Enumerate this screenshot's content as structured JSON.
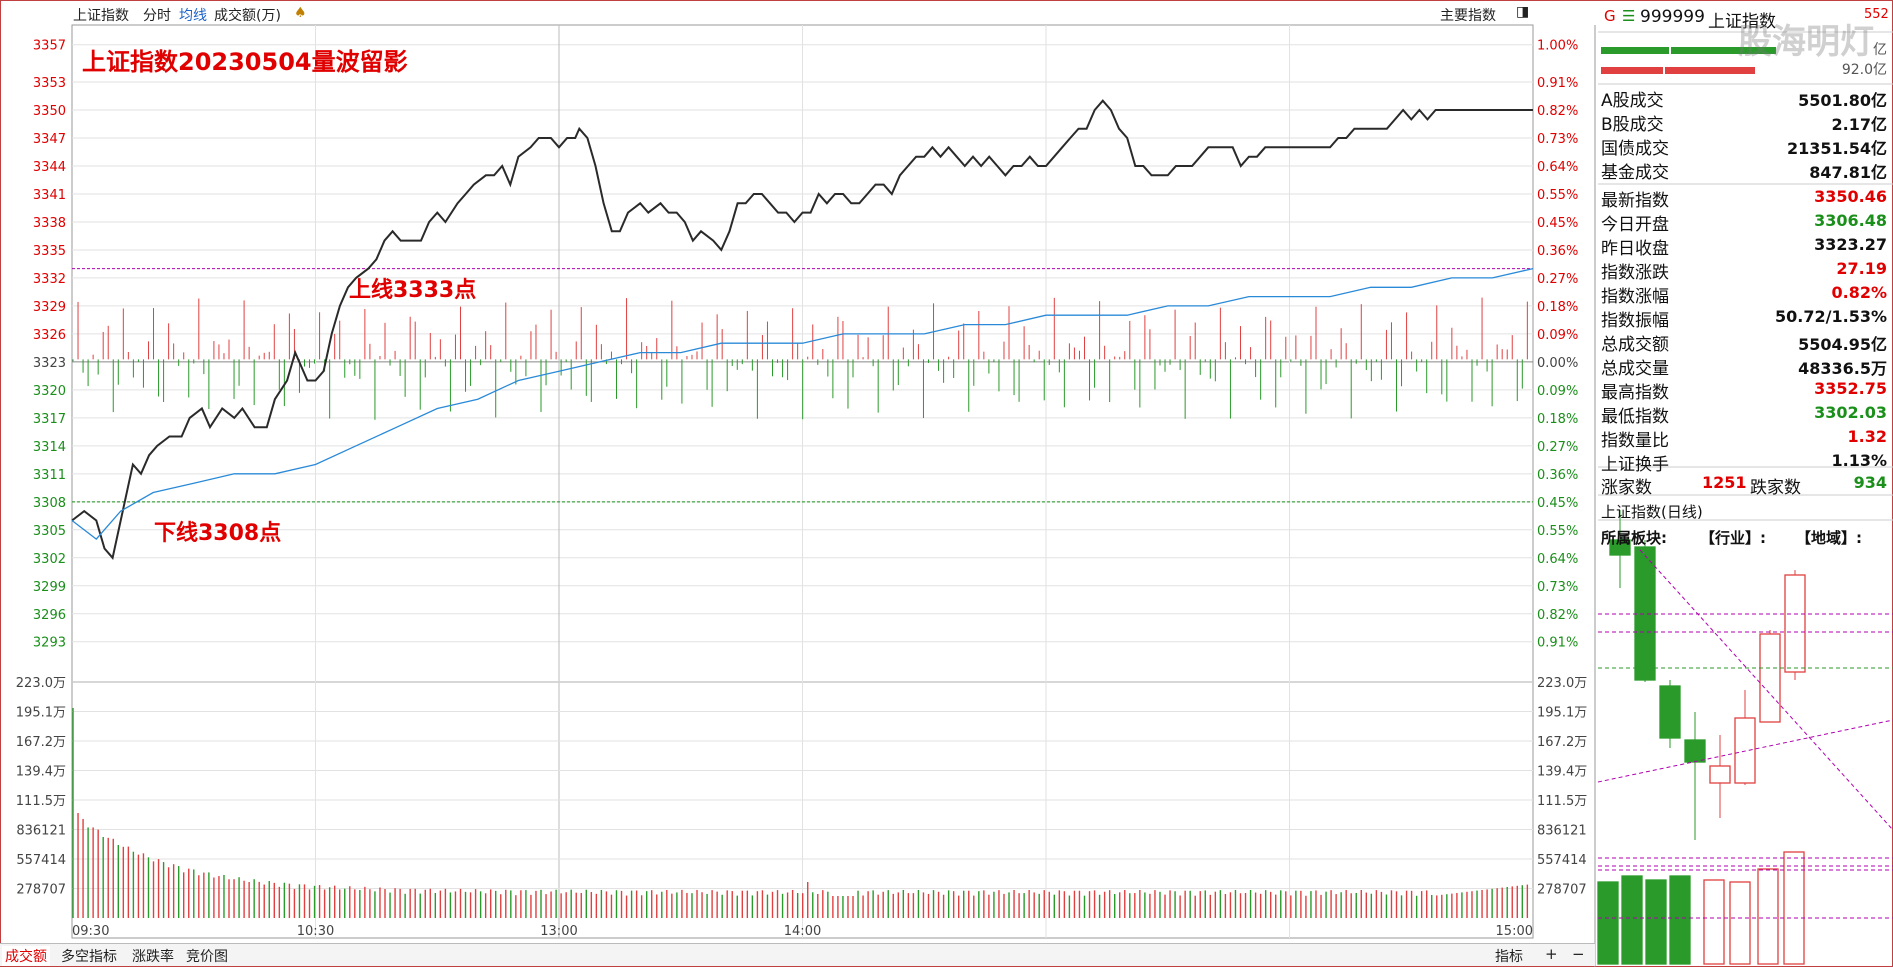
{
  "header": {
    "chart_name": "上证指数",
    "tabs": [
      "分时",
      "均线",
      "成交额(万)"
    ],
    "main_index_label": "主要指数"
  },
  "overlay": {
    "title": "上证指数20230504量波留影",
    "upper_line_text": "上线3333点",
    "lower_line_text": "下线3308点"
  },
  "bottom_tabs": {
    "items": [
      "成交额",
      "多空指标",
      "涨跌率",
      "竞价图"
    ],
    "indicator": "指标",
    "plus": "+",
    "minus": "−"
  },
  "sidebar": {
    "g_label": "G",
    "code": "999999",
    "name": "上证指数",
    "badge": "552",
    "watermark": "股海明灯",
    "bar_value_1": "亿",
    "bar_value_2": "92.0亿",
    "turnover": [
      {
        "label": "A股成交",
        "value": "5501.80亿"
      },
      {
        "label": "B股成交",
        "value": "2.17亿"
      },
      {
        "label": "国债成交",
        "value": "21351.54亿"
      },
      {
        "label": "基金成交",
        "value": "847.81亿"
      }
    ],
    "stats": [
      {
        "label": "最新指数",
        "value": "3350.46",
        "color": "#e00000"
      },
      {
        "label": "今日开盘",
        "value": "3306.48",
        "color": "#1a8f1a"
      },
      {
        "label": "昨日收盘",
        "value": "3323.27",
        "color": "#111111"
      },
      {
        "label": "指数涨跌",
        "value": "27.19",
        "color": "#e00000"
      },
      {
        "label": "指数涨幅",
        "value": "0.82%",
        "color": "#e00000"
      },
      {
        "label": "指数振幅",
        "value": "50.72/1.53%",
        "color": "#111111"
      },
      {
        "label": "总成交额",
        "value": "5504.95亿",
        "color": "#111111"
      },
      {
        "label": "总成交量",
        "value": "48336.5万",
        "color": "#111111"
      },
      {
        "label": "最高指数",
        "value": "3352.75",
        "color": "#e00000"
      },
      {
        "label": "最低指数",
        "value": "3302.03",
        "color": "#1a8f1a"
      },
      {
        "label": "指数量比",
        "value": "1.32",
        "color": "#e00000"
      },
      {
        "label": "上证换手",
        "value": "1.13%",
        "color": "#111111"
      }
    ],
    "advance_label": "涨家数",
    "advance_value": "1251",
    "decline_label": "跌家数",
    "decline_value": "934",
    "daily_title": "上证指数(日线)",
    "sector_label": "所属板块:",
    "industry_label": "【行业】:",
    "region_label": "【地域】:"
  },
  "chart_data": {
    "type": "line",
    "title": "上证指数20230504量波留影",
    "prev_close": 3323.27,
    "y_ticks": [
      "3357",
      "3353",
      "3350",
      "3347",
      "3344",
      "3341",
      "3338",
      "3335",
      "3332",
      "3329",
      "3326",
      "3323",
      "3320",
      "3317",
      "3314",
      "3311",
      "3308",
      "3305",
      "3302",
      "3299",
      "3296",
      "3293"
    ],
    "pct_ticks": [
      "1.00%",
      "0.91%",
      "0.82%",
      "0.73%",
      "0.64%",
      "0.55%",
      "0.45%",
      "0.36%",
      "0.27%",
      "0.18%",
      "0.09%",
      "0.00%",
      "0.09%",
      "0.18%",
      "0.27%",
      "0.36%",
      "0.45%",
      "0.55%",
      "0.64%",
      "0.73%",
      "0.82%",
      "0.91%"
    ],
    "ylim": [
      3291.9,
      3358.9
    ],
    "x_labels": [
      "09:30",
      "10:30",
      "13:00",
      "14:00",
      "15:00"
    ],
    "reference_lines": [
      {
        "label": "上线3333点",
        "value": 3333,
        "color": "#b000b0"
      },
      {
        "label": "下线3308点",
        "value": 3308,
        "color": "#1a8f1a"
      }
    ],
    "series": [
      {
        "values": [
          [
            0,
            3306
          ],
          [
            3,
            3307
          ],
          [
            6,
            3306
          ],
          [
            8,
            3303
          ],
          [
            10,
            3302
          ],
          [
            12,
            3306
          ],
          [
            14,
            3310
          ],
          [
            15,
            3312
          ],
          [
            17,
            3311
          ],
          [
            19,
            3313
          ],
          [
            21,
            3314
          ],
          [
            24,
            3315
          ],
          [
            27,
            3315
          ],
          [
            29,
            3317
          ],
          [
            32,
            3318
          ],
          [
            34,
            3316
          ],
          [
            37,
            3318
          ],
          [
            40,
            3317
          ],
          [
            42,
            3318
          ],
          [
            45,
            3316
          ],
          [
            48,
            3316
          ],
          [
            50,
            3319
          ],
          [
            53,
            3321
          ],
          [
            55,
            3324
          ],
          [
            58,
            3321
          ],
          [
            60,
            3321
          ],
          [
            62,
            3322
          ],
          [
            64,
            3326
          ],
          [
            66,
            3329
          ],
          [
            68,
            3331
          ],
          [
            70,
            3332
          ],
          [
            73,
            3333
          ],
          [
            75,
            3334
          ],
          [
            77,
            3336
          ],
          [
            79,
            3337
          ],
          [
            81,
            3336
          ],
          [
            83,
            3336
          ],
          [
            86,
            3336
          ],
          [
            88,
            3338
          ],
          [
            90,
            3339
          ],
          [
            92,
            3338
          ],
          [
            95,
            3340
          ],
          [
            97,
            3341
          ],
          [
            99,
            3342
          ],
          [
            102,
            3343
          ],
          [
            104,
            3343
          ],
          [
            106,
            3344
          ],
          [
            108,
            3342
          ],
          [
            110,
            3345
          ],
          [
            113,
            3346
          ],
          [
            115,
            3347
          ],
          [
            118,
            3347
          ],
          [
            120,
            3346
          ],
          [
            122,
            3347
          ],
          [
            124,
            3347
          ],
          [
            125,
            3348
          ],
          [
            127,
            3347
          ],
          [
            129,
            3344
          ],
          [
            131,
            3340
          ],
          [
            133,
            3337
          ],
          [
            135,
            3337
          ],
          [
            137,
            3339
          ],
          [
            140,
            3340
          ],
          [
            142,
            3339
          ],
          [
            145,
            3340
          ],
          [
            147,
            3339
          ],
          [
            149,
            3339
          ],
          [
            151,
            3338
          ],
          [
            153,
            3336
          ],
          [
            155,
            3337
          ],
          [
            158,
            3336
          ],
          [
            160,
            3335
          ],
          [
            162,
            3337
          ],
          [
            164,
            3340
          ],
          [
            166,
            3340
          ],
          [
            168,
            3341
          ],
          [
            170,
            3341
          ],
          [
            172,
            3340
          ],
          [
            174,
            3339
          ],
          [
            176,
            3339
          ],
          [
            178,
            3338
          ],
          [
            180,
            3339
          ],
          [
            182,
            3339
          ],
          [
            184,
            3341
          ],
          [
            186,
            3340
          ],
          [
            188,
            3341
          ],
          [
            190,
            3341
          ],
          [
            192,
            3340
          ],
          [
            194,
            3340
          ],
          [
            196,
            3341
          ],
          [
            198,
            3342
          ],
          [
            200,
            3342
          ],
          [
            202,
            3341
          ],
          [
            204,
            3343
          ],
          [
            206,
            3344
          ],
          [
            208,
            3345
          ],
          [
            210,
            3345
          ],
          [
            212,
            3346
          ],
          [
            214,
            3345
          ],
          [
            216,
            3346
          ],
          [
            218,
            3345
          ],
          [
            220,
            3344
          ],
          [
            222,
            3345
          ],
          [
            224,
            3344
          ],
          [
            226,
            3345
          ],
          [
            228,
            3344
          ],
          [
            230,
            3343
          ],
          [
            232,
            3344
          ],
          [
            234,
            3344
          ],
          [
            236,
            3345
          ],
          [
            238,
            3344
          ],
          [
            240,
            3344
          ],
          [
            242,
            3345
          ],
          [
            244,
            3346
          ],
          [
            246,
            3347
          ],
          [
            248,
            3348
          ],
          [
            250,
            3348
          ],
          [
            252,
            3350
          ],
          [
            254,
            3351
          ],
          [
            256,
            3350
          ],
          [
            258,
            3348
          ],
          [
            260,
            3347
          ],
          [
            262,
            3344
          ],
          [
            264,
            3344
          ],
          [
            266,
            3343
          ],
          [
            268,
            3343
          ],
          [
            270,
            3343
          ],
          [
            272,
            3344
          ],
          [
            274,
            3344
          ],
          [
            276,
            3344
          ],
          [
            278,
            3345
          ],
          [
            280,
            3346
          ],
          [
            282,
            3346
          ],
          [
            284,
            3346
          ],
          [
            286,
            3346
          ],
          [
            288,
            3344
          ],
          [
            290,
            3345
          ],
          [
            292,
            3345
          ],
          [
            294,
            3346
          ],
          [
            296,
            3346
          ],
          [
            298,
            3346
          ],
          [
            300,
            3346
          ],
          [
            302,
            3346
          ],
          [
            304,
            3346
          ],
          [
            306,
            3346
          ],
          [
            308,
            3346
          ],
          [
            310,
            3346
          ],
          [
            312,
            3347
          ],
          [
            314,
            3347
          ],
          [
            316,
            3348
          ],
          [
            318,
            3348
          ],
          [
            320,
            3348
          ],
          [
            322,
            3348
          ],
          [
            324,
            3348
          ],
          [
            326,
            3349
          ],
          [
            328,
            3350
          ],
          [
            330,
            3349
          ],
          [
            332,
            3350
          ],
          [
            334,
            3349
          ],
          [
            336,
            3350
          ],
          [
            338,
            3350
          ],
          [
            340,
            3350
          ],
          [
            342,
            3350
          ],
          [
            344,
            3350
          ],
          [
            346,
            3350
          ],
          [
            348,
            3350
          ],
          [
            350,
            3350
          ],
          [
            352,
            3350
          ],
          [
            354,
            3350
          ],
          [
            356,
            3350
          ],
          [
            358,
            3350
          ],
          [
            360,
            3350
          ]
        ]
      },
      {
        "values": [
          [
            0,
            3306
          ],
          [
            6,
            3304
          ],
          [
            12,
            3307
          ],
          [
            20,
            3309
          ],
          [
            30,
            3310
          ],
          [
            40,
            3311
          ],
          [
            50,
            3311
          ],
          [
            60,
            3312
          ],
          [
            70,
            3314
          ],
          [
            80,
            3316
          ],
          [
            90,
            3318
          ],
          [
            100,
            3319
          ],
          [
            110,
            3321
          ],
          [
            120,
            3322
          ],
          [
            130,
            3323
          ],
          [
            140,
            3324
          ],
          [
            150,
            3324
          ],
          [
            160,
            3325
          ],
          [
            170,
            3325
          ],
          [
            180,
            3325
          ],
          [
            190,
            3326
          ],
          [
            200,
            3326
          ],
          [
            210,
            3326
          ],
          [
            220,
            3327
          ],
          [
            230,
            3327
          ],
          [
            240,
            3328
          ],
          [
            250,
            3328
          ],
          [
            260,
            3328
          ],
          [
            270,
            3329
          ],
          [
            280,
            3329
          ],
          [
            290,
            3330
          ],
          [
            300,
            3330
          ],
          [
            310,
            3330
          ],
          [
            320,
            3331
          ],
          [
            330,
            3331
          ],
          [
            340,
            3332
          ],
          [
            350,
            3332
          ],
          [
            360,
            3333
          ]
        ]
      }
    ],
    "volume_ticks": [
      "223.0万",
      "195.1万",
      "167.2万",
      "139.4万",
      "111.5万",
      "836121",
      "557414",
      "278707"
    ],
    "volume_max": 2230000
  }
}
